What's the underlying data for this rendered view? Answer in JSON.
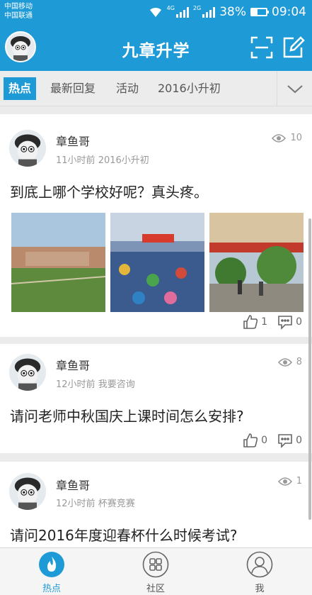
{
  "status_bar": {
    "carrier_1": "中国移动",
    "carrier_2": "中国联通",
    "net_1": "4G",
    "net_2": "2G",
    "battery": "38%",
    "time": "09:04"
  },
  "header": {
    "title": "九章升学",
    "scan_icon": "scan-icon",
    "edit_icon": "edit-icon"
  },
  "tabs": [
    {
      "label": "热点",
      "active": true
    },
    {
      "label": "最新回复"
    },
    {
      "label": "活动"
    },
    {
      "label": "2016小升初"
    }
  ],
  "posts": [
    {
      "author": "章鱼哥",
      "time": "11小时前",
      "category": "2016小升初",
      "views": "10",
      "title": "到底上哪个学校好呢？真头疼。",
      "images": [
        "campus-photo",
        "assembly-photo",
        "school-gate-photo"
      ],
      "likes": "1",
      "comments": "0"
    },
    {
      "author": "章鱼哥",
      "time": "12小时前",
      "category": "我要咨询",
      "views": "8",
      "title": "请问老师中秋国庆上课时间怎么安排?",
      "likes": "0",
      "comments": "0"
    },
    {
      "author": "章鱼哥",
      "time": "12小时前",
      "category": "杯赛竞赛",
      "views": "1",
      "title": "请问2016年度迎春杯什么时候考试?"
    }
  ],
  "bottom_nav": [
    {
      "label": "热点",
      "icon": "flame-icon",
      "active": true
    },
    {
      "label": "社区",
      "icon": "grid-icon"
    },
    {
      "label": "我",
      "icon": "user-icon"
    }
  ],
  "colors": {
    "brand": "#1e9ad6",
    "background": "#ebebeb",
    "text": "#222222",
    "muted": "#999999"
  }
}
